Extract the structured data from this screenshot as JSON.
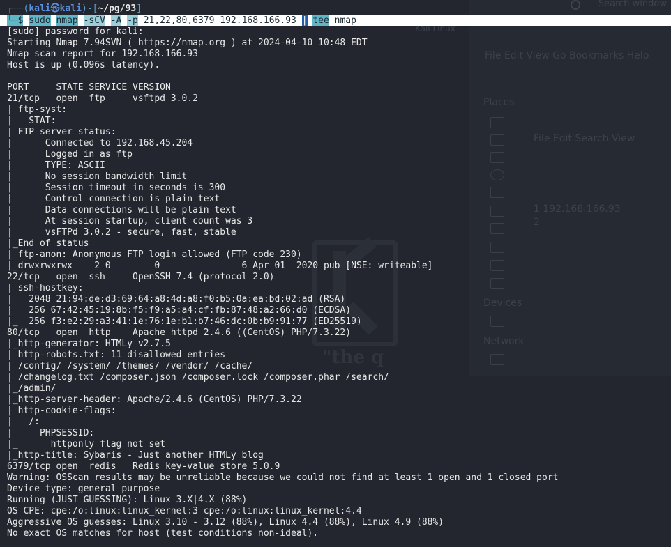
{
  "prompt": {
    "frame_left": "┌──(",
    "user": "kali",
    "at": "㉿",
    "host": "kali",
    "frame_mid": ")-[",
    "path": "~/pg/93",
    "frame_right": "]",
    "frame_bottom": "└─",
    "dollar": "$"
  },
  "command": {
    "sudo": "sudo",
    "nmap": "nmap",
    "flag1": "-sCV",
    "flag2": "-A",
    "flag3": "-p",
    "args": "21,22,80,6379 192.168.166.93",
    "pipe": "|",
    "tee": "tee",
    "outfile": "nmap"
  },
  "background_app": {
    "search_text": "Search window",
    "tab_label": "Kali Linux",
    "menu": "File  Edit  View  Go  Bookmarks  Help",
    "places_label": "Places",
    "devices_label": "Devices",
    "network_label": "Network",
    "editor_menu": "File  Edit  Search  View",
    "editor_line1": "1 192.168.166.93",
    "editor_line2": "2",
    "quote": "\"the q"
  },
  "output": [
    "[sudo] password for kali:",
    "Starting Nmap 7.94SVN ( https://nmap.org ) at 2024-04-10 10:48 EDT",
    "Nmap scan report for 192.168.166.93",
    "Host is up (0.096s latency).",
    "",
    "PORT     STATE SERVICE VERSION",
    "21/tcp   open  ftp     vsftpd 3.0.2",
    "| ftp-syst:",
    "|   STAT:",
    "| FTP server status:",
    "|      Connected to 192.168.45.204",
    "|      Logged in as ftp",
    "|      TYPE: ASCII",
    "|      No session bandwidth limit",
    "|      Session timeout in seconds is 300",
    "|      Control connection is plain text",
    "|      Data connections will be plain text",
    "|      At session startup, client count was 3",
    "|      vsFTPd 3.0.2 - secure, fast, stable",
    "|_End of status",
    "| ftp-anon: Anonymous FTP login allowed (FTP code 230)",
    "|_drwxrwxrwx    2 0        0               6 Apr 01  2020 pub [NSE: writeable]",
    "22/tcp   open  ssh     OpenSSH 7.4 (protocol 2.0)",
    "| ssh-hostkey:",
    "|   2048 21:94:de:d3:69:64:a8:4d:a8:f0:b5:0a:ea:bd:02:ad (RSA)",
    "|   256 67:42:45:19:8b:f5:f9:a5:a4:cf:fb:87:48:a2:66:d0 (ECDSA)",
    "|_  256 f3:e2:29:a3:41:1e:76:1e:b1:b7:46:dc:0b:b9:91:77 (ED25519)",
    "80/tcp   open  http    Apache httpd 2.4.6 ((CentOS) PHP/7.3.22)",
    "|_http-generator: HTMLy v2.7.5",
    "| http-robots.txt: 11 disallowed entries",
    "| /config/ /system/ /themes/ /vendor/ /cache/",
    "| /changelog.txt /composer.json /composer.lock /composer.phar /search/",
    "|_/admin/",
    "|_http-server-header: Apache/2.4.6 (CentOS) PHP/7.3.22",
    "| http-cookie-flags:",
    "|   /:",
    "|     PHPSESSID:",
    "|_      httponly flag not set",
    "|_http-title: Sybaris - Just another HTMLy blog",
    "6379/tcp open  redis   Redis key-value store 5.0.9",
    "Warning: OSScan results may be unreliable because we could not find at least 1 open and 1 closed port",
    "Device type: general purpose",
    "Running (JUST GUESSING): Linux 3.X|4.X (88%)",
    "OS CPE: cpe:/o:linux:linux_kernel:3 cpe:/o:linux:linux_kernel:4.4",
    "Aggressive OS guesses: Linux 3.10 - 3.12 (88%), Linux 4.4 (88%), Linux 4.9 (88%)",
    "No exact OS matches for host (test conditions non-ideal)."
  ]
}
